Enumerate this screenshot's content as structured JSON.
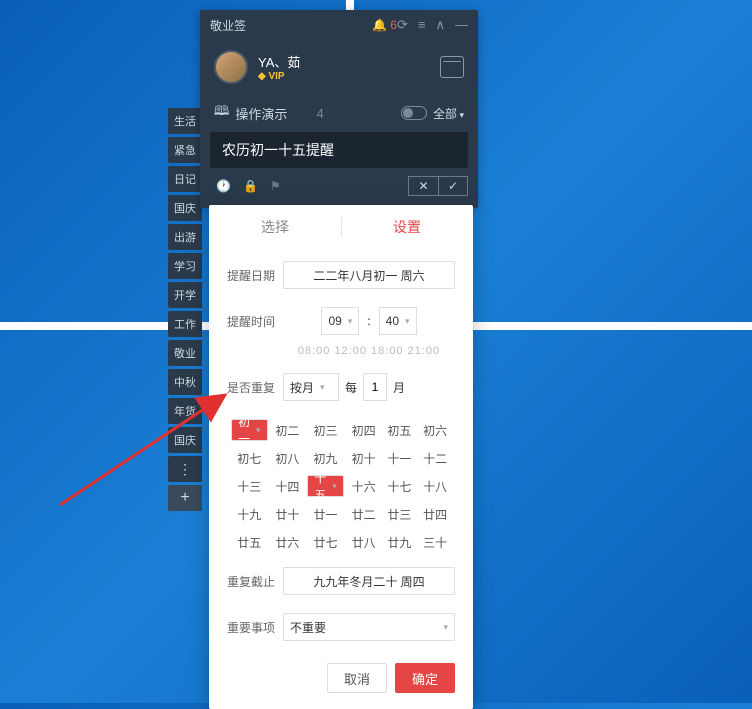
{
  "titlebar": {
    "app_name": "敬业签",
    "notif_count": "6"
  },
  "profile": {
    "name": "YA、茹",
    "vip": "VIP"
  },
  "section": {
    "title": "操作演示",
    "count": "4",
    "all": "全部"
  },
  "input": {
    "value": "农历初一十五提醒"
  },
  "tags": [
    "生活",
    "紧急",
    "日记",
    "国庆",
    "出游",
    "学习",
    "开学",
    "工作",
    "敬业",
    "中秋",
    "年货",
    "国庆"
  ],
  "panel": {
    "tab_select": "选择",
    "tab_settings": "设置",
    "remind_date_label": "提醒日期",
    "remind_date_value": "二二年八月初一 周六",
    "remind_time_label": "提醒时间",
    "hour": "09",
    "minute": "40",
    "quick_times": "08:00  12:00  18:00  21:00",
    "repeat_label": "是否重复",
    "repeat_unit": "按月",
    "mei": "每",
    "repeat_num": "1",
    "yue": "月",
    "lunar": [
      "初一",
      "初二",
      "初三",
      "初四",
      "初五",
      "初六",
      "初七",
      "初八",
      "初九",
      "初十",
      "十一",
      "十二",
      "十三",
      "十四",
      "十五",
      "十六",
      "十七",
      "十八",
      "十九",
      "廿十",
      "廿一",
      "廿二",
      "廿三",
      "廿四",
      "廿五",
      "廿六",
      "廿七",
      "廿八",
      "廿九",
      "三十"
    ],
    "lunar_selected": [
      0,
      14
    ],
    "end_label": "重复截止",
    "end_value": "九九年冬月二十 周四",
    "importance_label": "重要事项",
    "importance_value": "不重要",
    "cancel": "取消",
    "confirm": "确定"
  }
}
